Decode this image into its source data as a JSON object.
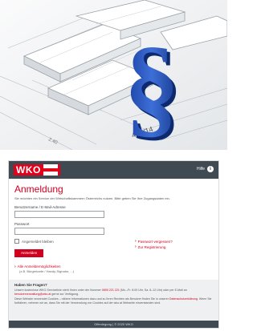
{
  "hero": {
    "image_description_name": "legal-paragraph-hero"
  },
  "header": {
    "logo_text": "WKO",
    "help_label": "Hilfe",
    "colors": {
      "bar": "#3f4a53",
      "brand": "#e2001a"
    }
  },
  "login": {
    "title": "Anmeldung",
    "intro": "Sie möchten ein Service der Wirtschaftskammern Österreichs nutzen. Bitte geben Sie Ihre Zugangsdaten ein.",
    "username_label": "Benutzername / E-Mail-Adresse",
    "username_value": "",
    "password_label": "Passwort",
    "password_value": "",
    "remember_label": "Angemeldet bleiben",
    "submit_label": "Anmelden",
    "forgot_label": "Passwort vergessen?",
    "register_label": "Zur Registrierung",
    "more_options_label": "Alle Anmeldemöglichkeiten",
    "more_options_sub": "(z.B. Bürgerkarte / Handy-Signatur, ...)"
  },
  "info": {
    "heading": "Haben Sie Fragen?",
    "line1_pre": "Unsere kostenlose WKO-Servicelinie steht Ihnen unter der Nummer ",
    "phone": "0800 221 221",
    "line1_post": " (Mo.–Fr. 8:00 Uhr, Sa. 8–12 Uhr) oder per",
    "line2_pre": "E-Mail an ",
    "email": "benutzerverwaltung@wko.at",
    "line2_post": " gerne zur Verfügung.",
    "cookie_text": "Diese Website verwendet Cookies – nähere Informationen dazu und zu Ihren Rechten als Benutzer finden Sie in unserer",
    "cookie_link": "Datenschutzerklärung",
    "cookie_text2": ". Wenn Sie fortfahren, nehmen wir an, dass Sie mit der Verwendung von Cookies auf der wko.at Webseite einverstanden sind."
  },
  "footer": {
    "imprint": "Offenlegung",
    "separator": "|",
    "copyright": "© 2020 WKO"
  }
}
